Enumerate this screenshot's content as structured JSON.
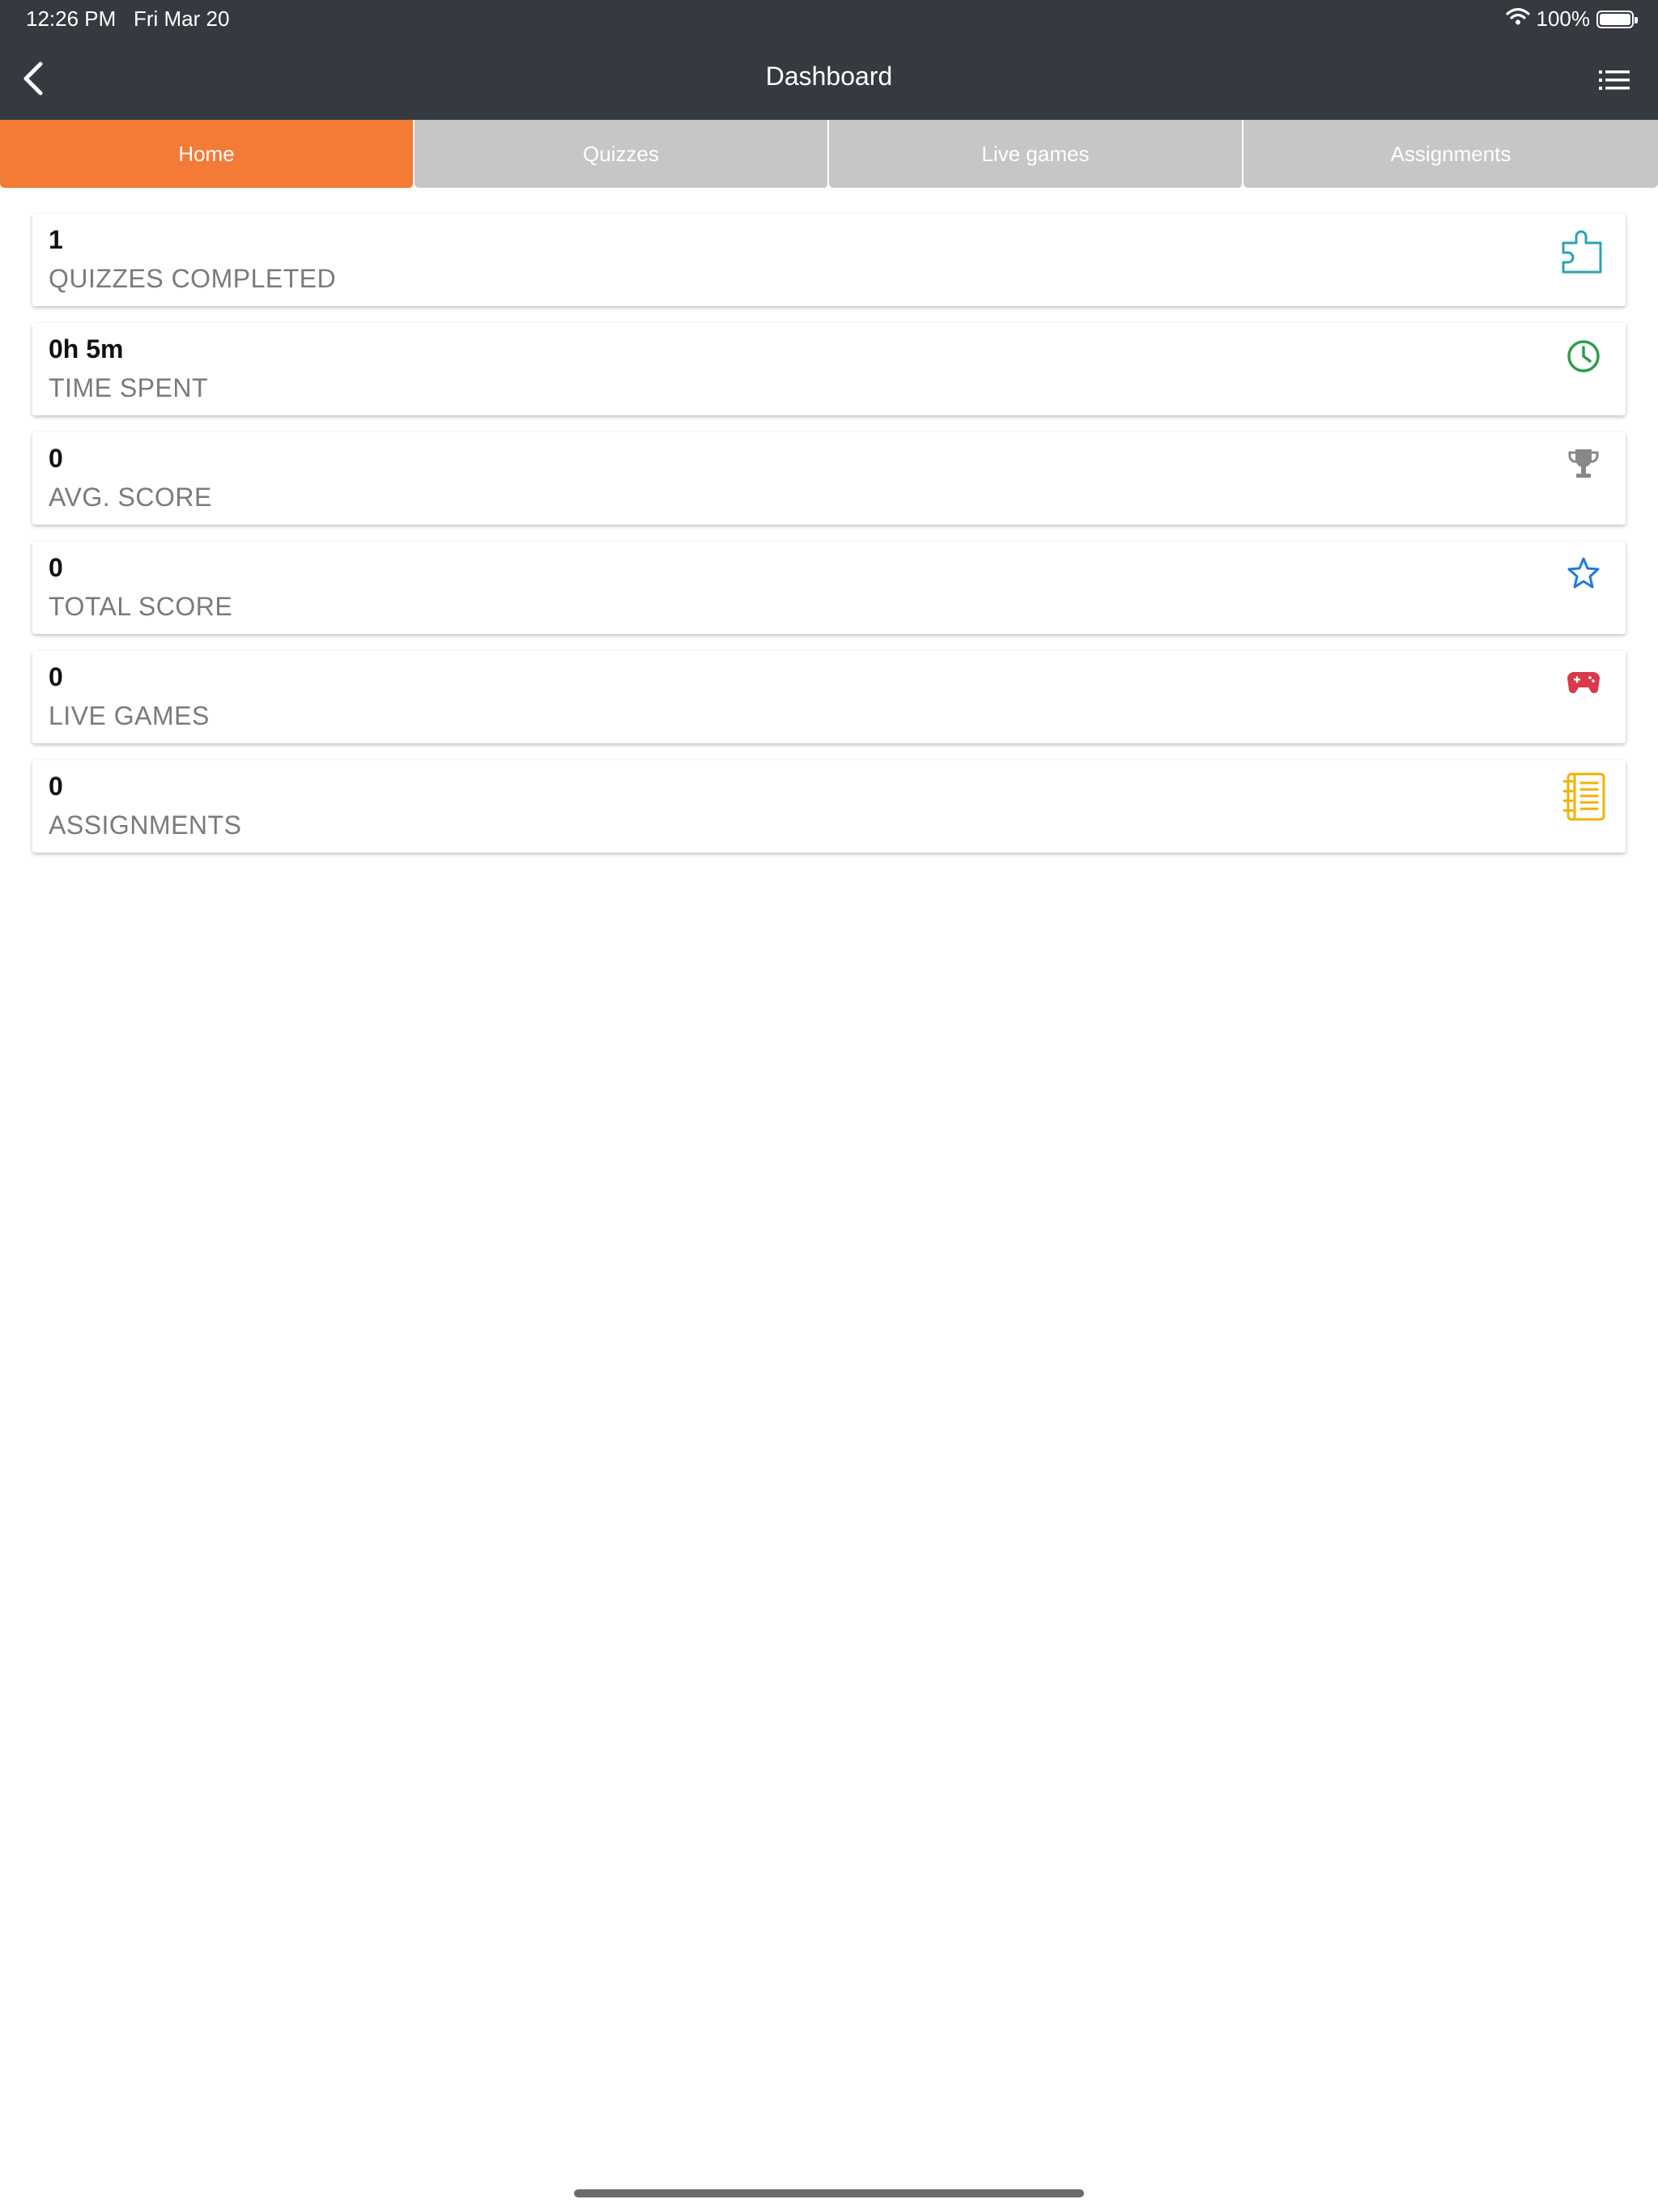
{
  "status_bar": {
    "time": "12:26 PM",
    "date": "Fri Mar 20",
    "battery": "100%",
    "icons": [
      "wifi-icon",
      "battery-icon"
    ]
  },
  "header": {
    "title": "Dashboard",
    "back_icon": "chevron-left-icon",
    "menu_icon": "list-icon"
  },
  "tabs": [
    {
      "label": "Home",
      "active": true
    },
    {
      "label": "Quizzes",
      "active": false
    },
    {
      "label": "Live games",
      "active": false
    },
    {
      "label": "Assignments",
      "active": false
    }
  ],
  "stats": [
    {
      "value": "1",
      "label": "QUIZZES COMPLETED",
      "icon": "puzzle-icon",
      "color": "#2aa3b5"
    },
    {
      "value": "0h 5m",
      "label": "TIME SPENT",
      "icon": "clock-icon",
      "color": "#2e9e4a"
    },
    {
      "value": "0",
      "label": "AVG. SCORE",
      "icon": "trophy-icon",
      "color": "#888888"
    },
    {
      "value": "0",
      "label": "TOTAL SCORE",
      "icon": "star-icon",
      "color": "#1f7ae0"
    },
    {
      "value": "0",
      "label": "LIVE GAMES",
      "icon": "gamepad-icon",
      "color": "#d9394a"
    },
    {
      "value": "0",
      "label": "ASSIGNMENTS",
      "icon": "notebook-icon",
      "color": "#f0b300"
    }
  ],
  "colors": {
    "topbar": "#353a40",
    "tab_active": "#f47b36",
    "tab_inactive": "#c6c6c6"
  }
}
